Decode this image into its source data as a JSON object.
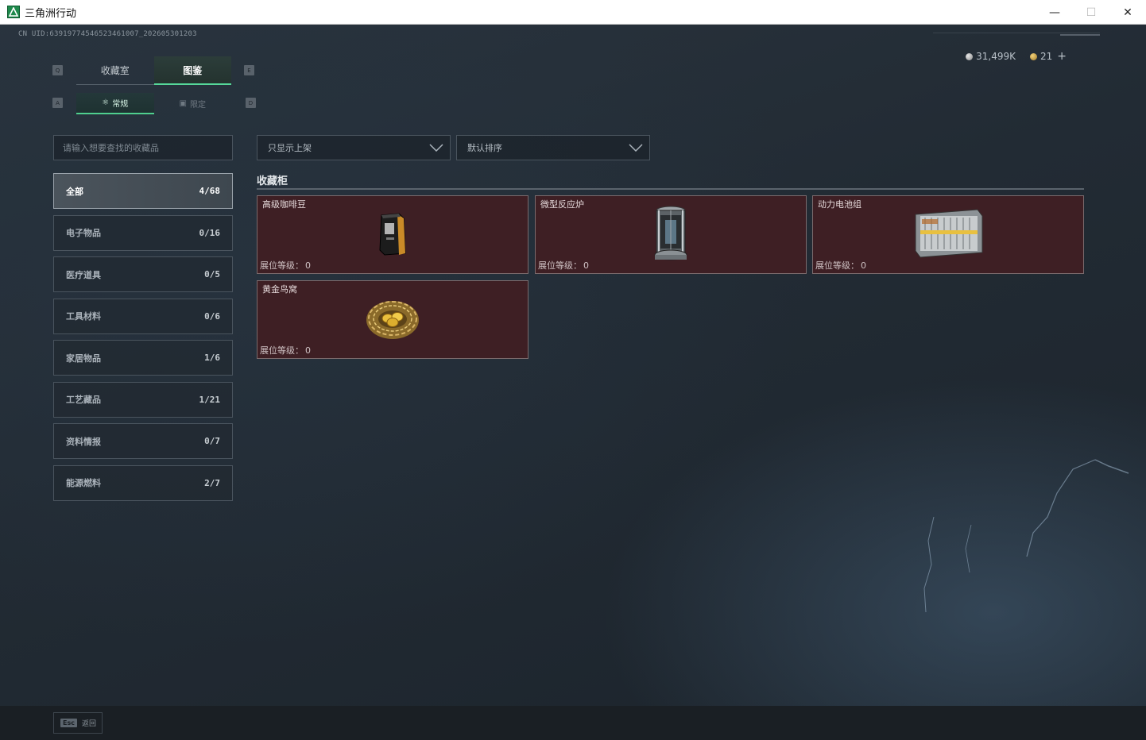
{
  "window": {
    "title": "三角洲行动",
    "minimize": "—",
    "maximize": "☐",
    "close": "✕"
  },
  "uid": "CN UID:63919774546523461007_202605301203",
  "currency": {
    "silver": "31,499K",
    "gold": "21",
    "add": "+"
  },
  "keys": {
    "tab_prev": "Q",
    "tab_next": "E",
    "sub_prev": "A",
    "sub_next": "D"
  },
  "main_tabs": [
    {
      "label": "收藏室",
      "active": false
    },
    {
      "label": "图鉴",
      "active": true
    }
  ],
  "sub_tabs": [
    {
      "label": "常规",
      "active": true
    },
    {
      "label": "限定",
      "active": false
    }
  ],
  "search": {
    "placeholder": "请输入想要查找的收藏品"
  },
  "categories": [
    {
      "label": "全部",
      "count": "4/68",
      "active": true
    },
    {
      "label": "电子物品",
      "count": "0/16",
      "active": false
    },
    {
      "label": "医疗道具",
      "count": "0/5",
      "active": false
    },
    {
      "label": "工具材料",
      "count": "0/6",
      "active": false
    },
    {
      "label": "家居物品",
      "count": "1/6",
      "active": false
    },
    {
      "label": "工艺藏品",
      "count": "1/21",
      "active": false
    },
    {
      "label": "资料情报",
      "count": "0/7",
      "active": false
    },
    {
      "label": "能源燃料",
      "count": "2/7",
      "active": false
    }
  ],
  "filters": {
    "display": "只显示上架",
    "sort": "默认排序"
  },
  "section": {
    "title": "收藏柜"
  },
  "items": [
    {
      "name": "高级咖啡豆",
      "level_label": "展位等级：",
      "level": "0",
      "icon": "coffee-bag-icon"
    },
    {
      "name": "微型反应炉",
      "level_label": "展位等级：",
      "level": "0",
      "icon": "reactor-icon"
    },
    {
      "name": "动力电池组",
      "level_label": "展位等级：",
      "level": "0",
      "icon": "battery-pack-icon"
    },
    {
      "name": "黄金鸟窝",
      "level_label": "展位等级：",
      "level": "0",
      "icon": "golden-nest-icon"
    }
  ],
  "footer": {
    "esc_key": "Esc",
    "esc_label": "返回"
  },
  "colors": {
    "accent_green": "#56d89a",
    "card_bg": "#3e1f24",
    "card_border": "#7a6a6c"
  }
}
